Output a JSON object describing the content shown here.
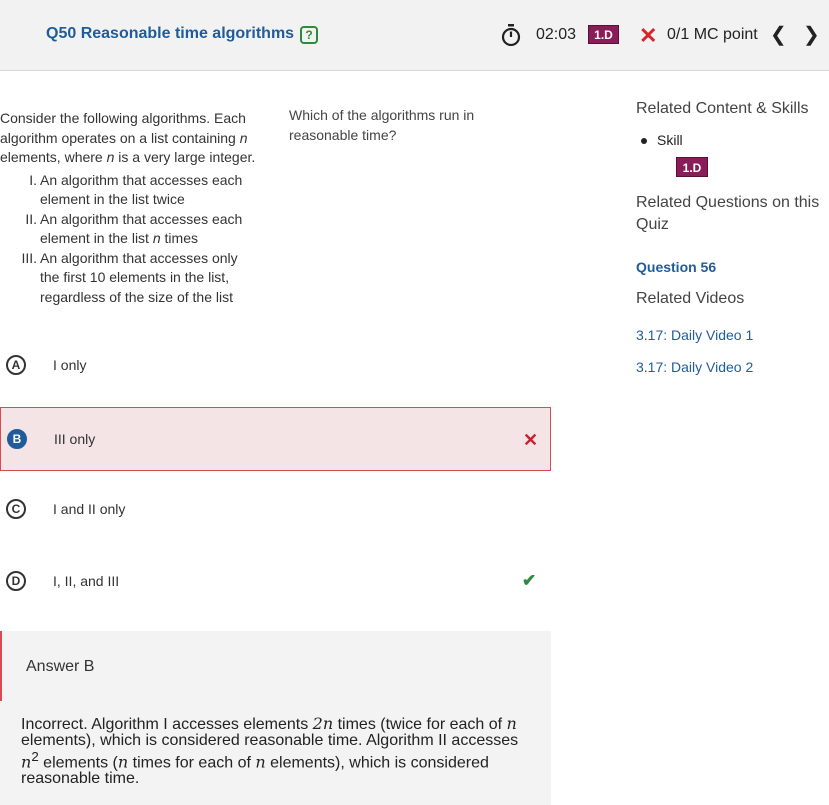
{
  "header": {
    "question_title": "Q50 Reasonable time algorithms",
    "help_symbol": "?",
    "timer": "02:03",
    "skill_badge": "1.D",
    "score": "0/1 MC point",
    "incorrect_symbol": "✕",
    "prev_symbol": "❮",
    "next_symbol": "❯",
    "icons": [
      "help-icon",
      "stopwatch-icon",
      "incorrect-x-icon",
      "chevron-left-icon",
      "chevron-right-icon"
    ]
  },
  "stimulus": {
    "intro_a": "Consider the following algorithms. Each algorithm operates on a list containing ",
    "intro_var": "n",
    "intro_b": " elements, where ",
    "intro_var2": "n",
    "intro_c": " is a very large integer.",
    "items": [
      {
        "num": "I.",
        "text_a": "An algorithm that accesses each element in the list twice",
        "var": "",
        "text_b": ""
      },
      {
        "num": "II.",
        "text_a": "An algorithm that accesses each element in the list ",
        "var": "n",
        "text_b": " times"
      },
      {
        "num": "III.",
        "text_a": "An algorithm that accesses only the first 10 elements in the list, regardless of the size of the list",
        "var": "",
        "text_b": ""
      }
    ]
  },
  "question": "Which of the algorithms run in reasonable time?",
  "options": [
    {
      "letter": "A",
      "text": "I only",
      "selected": false,
      "mark": ""
    },
    {
      "letter": "B",
      "text": "III only",
      "selected": true,
      "mark": "✕"
    },
    {
      "letter": "C",
      "text": "I and II only",
      "selected": false,
      "mark": ""
    },
    {
      "letter": "D",
      "text": "I, II, and III",
      "selected": false,
      "mark": "✔"
    }
  ],
  "answer": {
    "label": "Answer B",
    "exp_1": "Incorrect. Algorithm I accesses elements ",
    "exp_math1": "2n",
    "exp_2": " times (twice for each of ",
    "exp_var1": "n",
    "exp_3": " elements), which is considered reasonable time. Algorithm II accesses ",
    "exp_math2": "n",
    "exp_sup": "2",
    "exp_4": " elements (",
    "exp_var2": "n",
    "exp_5": " times for each of ",
    "exp_var3": "n",
    "exp_6": " elements), which is considered reasonable time."
  },
  "sidebar": {
    "related_heading": "Related Content & Skills",
    "skill_label": "Skill",
    "skill_badge": "1.D",
    "related_questions_heading": "Related Questions on this Quiz",
    "question_link": "Question 56",
    "videos_heading": "Related Videos",
    "videos": [
      "3.17: Daily Video 1",
      "3.17: Daily Video 2"
    ]
  },
  "colors": {
    "brand_blue": "#1f5c99",
    "skill_magenta": "#8a1c58",
    "incorrect_red": "#d7242b",
    "correct_green": "#2e8b3d",
    "selected_bg": "#f5e4e6"
  }
}
